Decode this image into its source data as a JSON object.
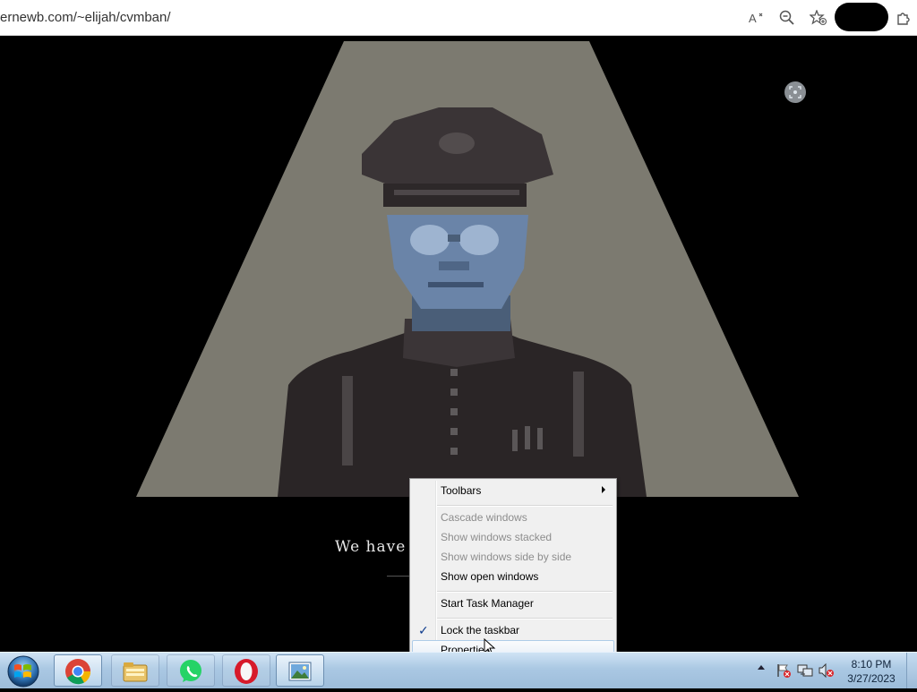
{
  "browser": {
    "url": "ernewb.com/~elijah/cvmban/",
    "icons": [
      "read-aloud-icon",
      "zoom-out-icon",
      "add-favorite-icon",
      "profile-avatar",
      "extensions-icon"
    ]
  },
  "game": {
    "subtitle": "We have au",
    "fullscreen_icon": "screen-capture-icon"
  },
  "context_menu": {
    "toolbars": "Toolbars",
    "cascade": "Cascade windows",
    "stacked": "Show windows stacked",
    "side_by_side": "Show windows side by side",
    "show_open": "Show open windows",
    "task_manager": "Start Task Manager",
    "lock_taskbar": "Lock the taskbar",
    "lock_checked": "✓",
    "properties": "Properties"
  },
  "taskbar": {
    "start_icon": "windows-start-orb",
    "apps": [
      "chrome-icon",
      "file-explorer-icon",
      "whatsapp-icon",
      "opera-icon",
      "image-viewer-icon"
    ],
    "tray_icons": [
      "action-center-flag-icon",
      "network-icon",
      "volume-muted-icon"
    ],
    "clock": {
      "time": "8:10 PM",
      "date": "3/27/2023"
    }
  },
  "colors": {
    "spotlight": "#7c7a70",
    "taskbar_top": "#cfe3f4",
    "menu_bg": "#f0f0f0",
    "menu_hover_border": "#aecce8"
  }
}
